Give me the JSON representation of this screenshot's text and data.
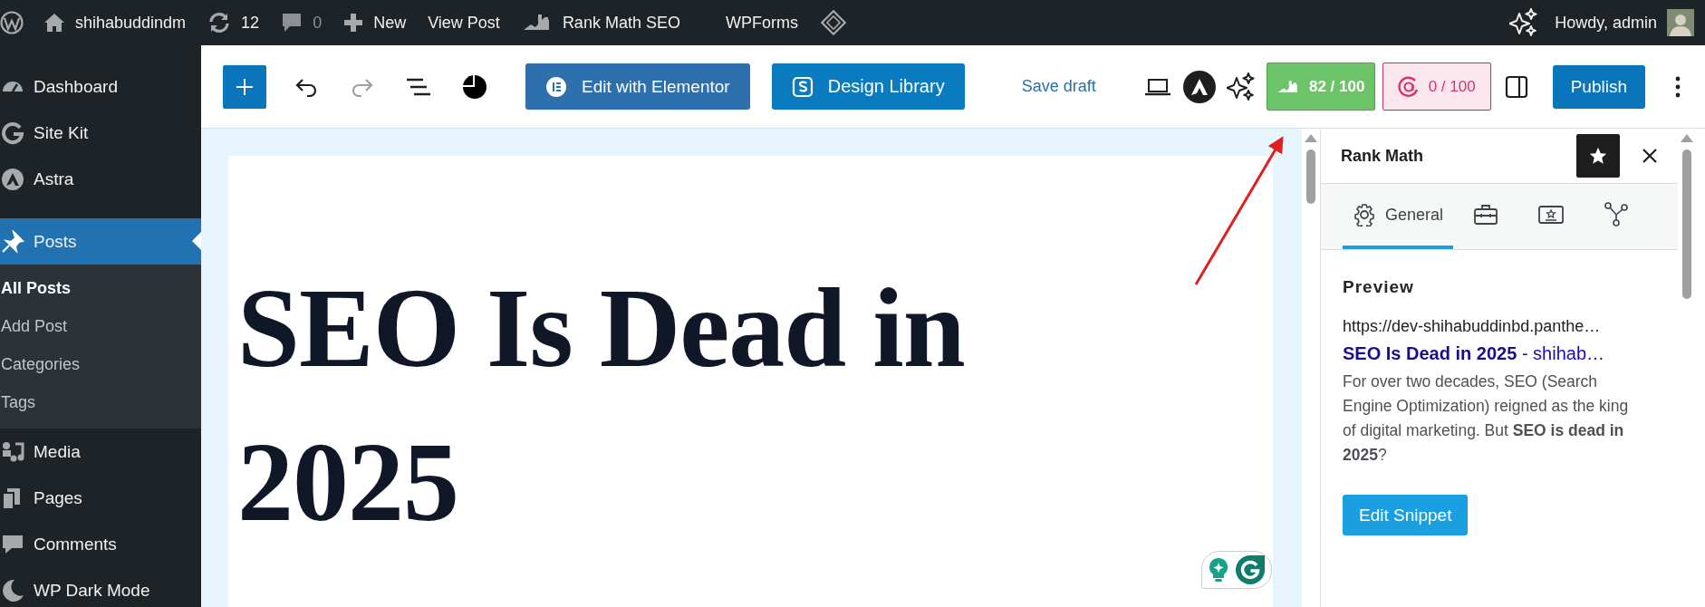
{
  "admin_bar": {
    "left": [
      {
        "kind": "wp"
      },
      {
        "kind": "home",
        "label": "shihabuddindm"
      },
      {
        "kind": "updates",
        "label": "12"
      },
      {
        "kind": "comments",
        "label": "0"
      },
      {
        "kind": "new",
        "label": "New"
      },
      {
        "kind": "text",
        "label": "View Post"
      },
      {
        "kind": "rankmath",
        "label": "Rank Math SEO"
      },
      {
        "kind": "text",
        "label": "WPForms"
      },
      {
        "kind": "diamond"
      }
    ],
    "right": [
      {
        "kind": "sparkle"
      },
      {
        "kind": "account",
        "label": "Howdy, admin"
      }
    ]
  },
  "sidebar": {
    "items": [
      {
        "label": "Dashboard",
        "kind": "dashboard",
        "selected": false
      },
      {
        "label": "Site Kit",
        "kind": "sitekit",
        "selected": false
      },
      {
        "label": "Astra",
        "kind": "astra",
        "selected": false
      },
      {
        "label": "Posts",
        "kind": "pin",
        "selected": true,
        "children": [
          {
            "label": "All Posts",
            "selected": true
          },
          {
            "label": "Add Post",
            "selected": false
          },
          {
            "label": "Categories",
            "selected": false
          },
          {
            "label": "Tags",
            "selected": false
          }
        ]
      },
      {
        "label": "Media",
        "kind": "media",
        "selected": false
      },
      {
        "label": "Pages",
        "kind": "pages",
        "selected": false
      },
      {
        "label": "Comments",
        "kind": "comments",
        "selected": false
      },
      {
        "label": "WP Dark Mode",
        "kind": "moon",
        "selected": false
      }
    ]
  },
  "toolbar": {
    "left": [
      {
        "kind": "inserter"
      },
      {
        "kind": "undo",
        "disabled": false
      },
      {
        "kind": "redo",
        "disabled": true
      },
      {
        "kind": "listview"
      },
      {
        "kind": "pie"
      }
    ],
    "buttons": [
      {
        "kind": "elementor",
        "label": "Edit with Elementor"
      },
      {
        "kind": "library",
        "label": "Design Library"
      }
    ],
    "right": [
      {
        "kind": "save",
        "label": "Save draft"
      },
      {
        "kind": "preview"
      },
      {
        "kind": "astra"
      },
      {
        "kind": "sparkle"
      },
      {
        "kind": "seo_score",
        "label": "82 / 100"
      },
      {
        "kind": "content_score",
        "label": "0 / 100"
      },
      {
        "kind": "sidebar"
      },
      {
        "kind": "publish",
        "label": "Publish"
      },
      {
        "kind": "more"
      }
    ]
  },
  "editor": {
    "title": "SEO Is Dead in 2025"
  },
  "panel": {
    "title": "Rank Math",
    "pinned": true,
    "tabs": [
      {
        "kind": "general",
        "label": "General",
        "selected": true
      },
      {
        "kind": "advanced",
        "selected": false
      },
      {
        "kind": "schema",
        "selected": false
      },
      {
        "kind": "social",
        "selected": false
      }
    ],
    "preview": {
      "heading": "Preview",
      "url": "https://dev-shihabuddinbd.panthe…",
      "title": "**SEO Is Dead in 2025** - shihab…",
      "description": "For over two decades, SEO (Search Engine Optimization) reigned as the king of digital marketing. But **SEO is dead in 2025**?",
      "button": "Edit Snippet"
    }
  }
}
